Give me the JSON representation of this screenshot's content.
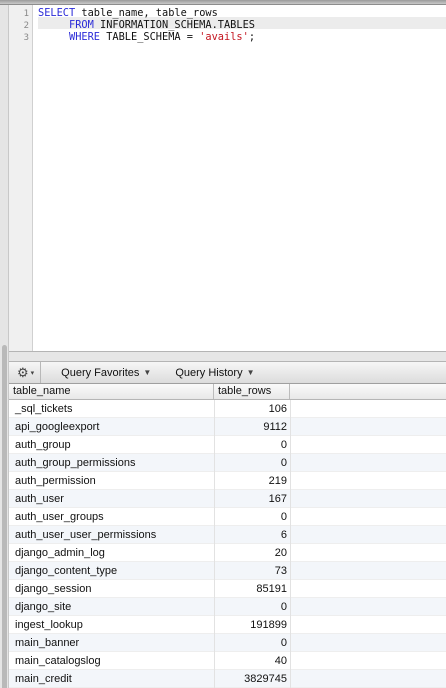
{
  "editor": {
    "line_numbers": [
      "1",
      "2",
      "3"
    ],
    "lines": [
      [
        {
          "t": "SELECT",
          "k": "kw"
        },
        {
          "t": " table_name, table_rows",
          "k": ""
        }
      ],
      [
        {
          "t": "     FROM",
          "k": "kw"
        },
        {
          "t": " INFORMATION_SCHEMA.TABLES",
          "k": ""
        }
      ],
      [
        {
          "t": "     WHERE",
          "k": "kw"
        },
        {
          "t": " TABLE_SCHEMA = ",
          "k": ""
        },
        {
          "t": "'avails'",
          "k": "str"
        },
        {
          "t": ";",
          "k": ""
        }
      ]
    ]
  },
  "toolbar": {
    "gear_icon": "gear-icon",
    "query_favorites_label": "Query Favorites",
    "query_history_label": "Query History"
  },
  "results": {
    "columns": [
      "table_name",
      "table_rows"
    ],
    "rows": [
      {
        "name": "_sql_tickets",
        "rows": "106"
      },
      {
        "name": "api_googleexport",
        "rows": "9112"
      },
      {
        "name": "auth_group",
        "rows": "0"
      },
      {
        "name": "auth_group_permissions",
        "rows": "0"
      },
      {
        "name": "auth_permission",
        "rows": "219"
      },
      {
        "name": "auth_user",
        "rows": "167"
      },
      {
        "name": "auth_user_groups",
        "rows": "0"
      },
      {
        "name": "auth_user_user_permissions",
        "rows": "6"
      },
      {
        "name": "django_admin_log",
        "rows": "20"
      },
      {
        "name": "django_content_type",
        "rows": "73"
      },
      {
        "name": "django_session",
        "rows": "85191"
      },
      {
        "name": "django_site",
        "rows": "0"
      },
      {
        "name": "ingest_lookup",
        "rows": "191899"
      },
      {
        "name": "main_banner",
        "rows": "0"
      },
      {
        "name": "main_catalogslog",
        "rows": "40"
      },
      {
        "name": "main_credit",
        "rows": "3829745"
      }
    ]
  },
  "colors": {
    "keyword": "#2a2ad8",
    "string": "#c4141f",
    "row_alt": "#f3f6fa"
  }
}
